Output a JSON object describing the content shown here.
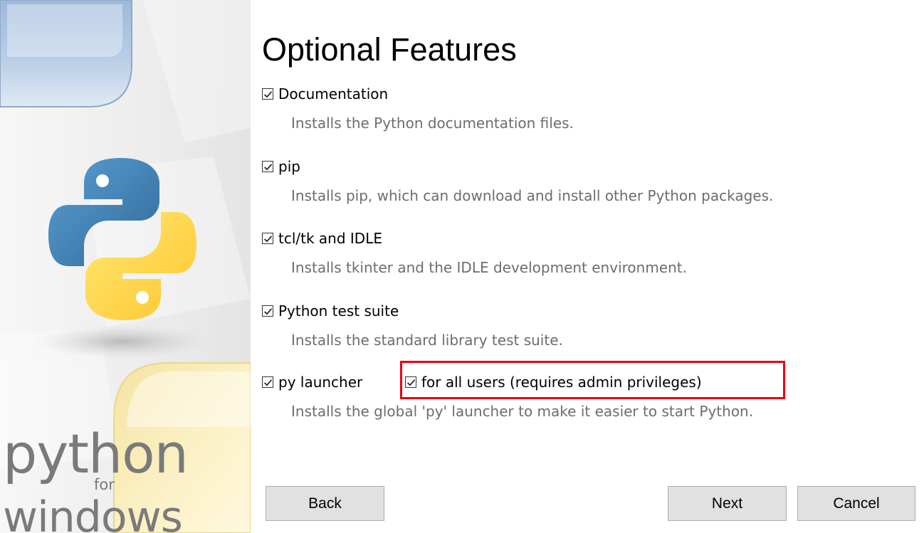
{
  "title": "Optional Features",
  "brand": {
    "python": "python",
    "for": "for",
    "windows": "windows"
  },
  "features": [
    {
      "label": "Documentation",
      "checked": true,
      "description": "Installs the Python documentation files."
    },
    {
      "label": "pip",
      "checked": true,
      "description": "Installs pip, which can download and install other Python packages."
    },
    {
      "label": "tcl/tk and IDLE",
      "checked": true,
      "description": "Installs tkinter and the IDLE development environment."
    },
    {
      "label": "Python test suite",
      "checked": true,
      "description": "Installs the standard library test suite."
    },
    {
      "label": "py launcher",
      "checked": true,
      "description": "Installs the global 'py' launcher to make it easier to start Python."
    }
  ],
  "for_all_users": {
    "label": "for all users (requires admin privileges)",
    "checked": true,
    "highlight_color": "#e8000f"
  },
  "buttons": {
    "back": "Back",
    "next": "Next",
    "cancel": "Cancel"
  },
  "colors": {
    "python_blue": "#3a6f9e",
    "python_yellow": "#f5c93a",
    "description_gray": "#6d6d6d"
  },
  "icons": {
    "checkbox": "checkbox-checked-icon",
    "logo": "python-logo-icon"
  }
}
